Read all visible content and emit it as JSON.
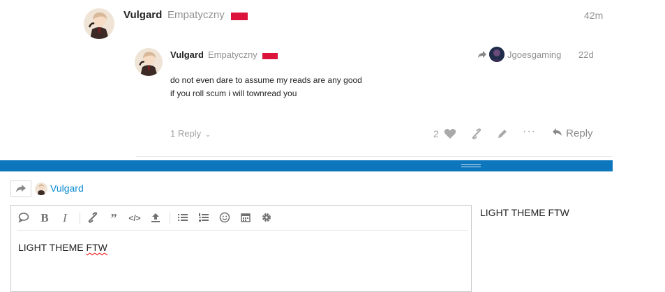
{
  "post": {
    "username": "Vulgard",
    "title": "Empatyczny",
    "time": "42m"
  },
  "reply": {
    "username": "Vulgard",
    "title": "Empatyczny",
    "reply_to_user": "Jgoesgaming",
    "time": "22d",
    "line1": "do not even dare to assume my reads are any good",
    "line2": "if you roll scum i will townread you",
    "replies_label": "1 Reply",
    "like_count": "2",
    "reply_button": "Reply"
  },
  "composer": {
    "reply_to_user": "Vulgard",
    "content_prefix": "LIGHT THEME ",
    "content_misspelled": "FTW",
    "preview_text": "LIGHT THEME FTW"
  },
  "colors": {
    "accent_blue": "#0e76bd",
    "link_blue": "#0a8ad2",
    "flag_red": "#dc143c"
  }
}
